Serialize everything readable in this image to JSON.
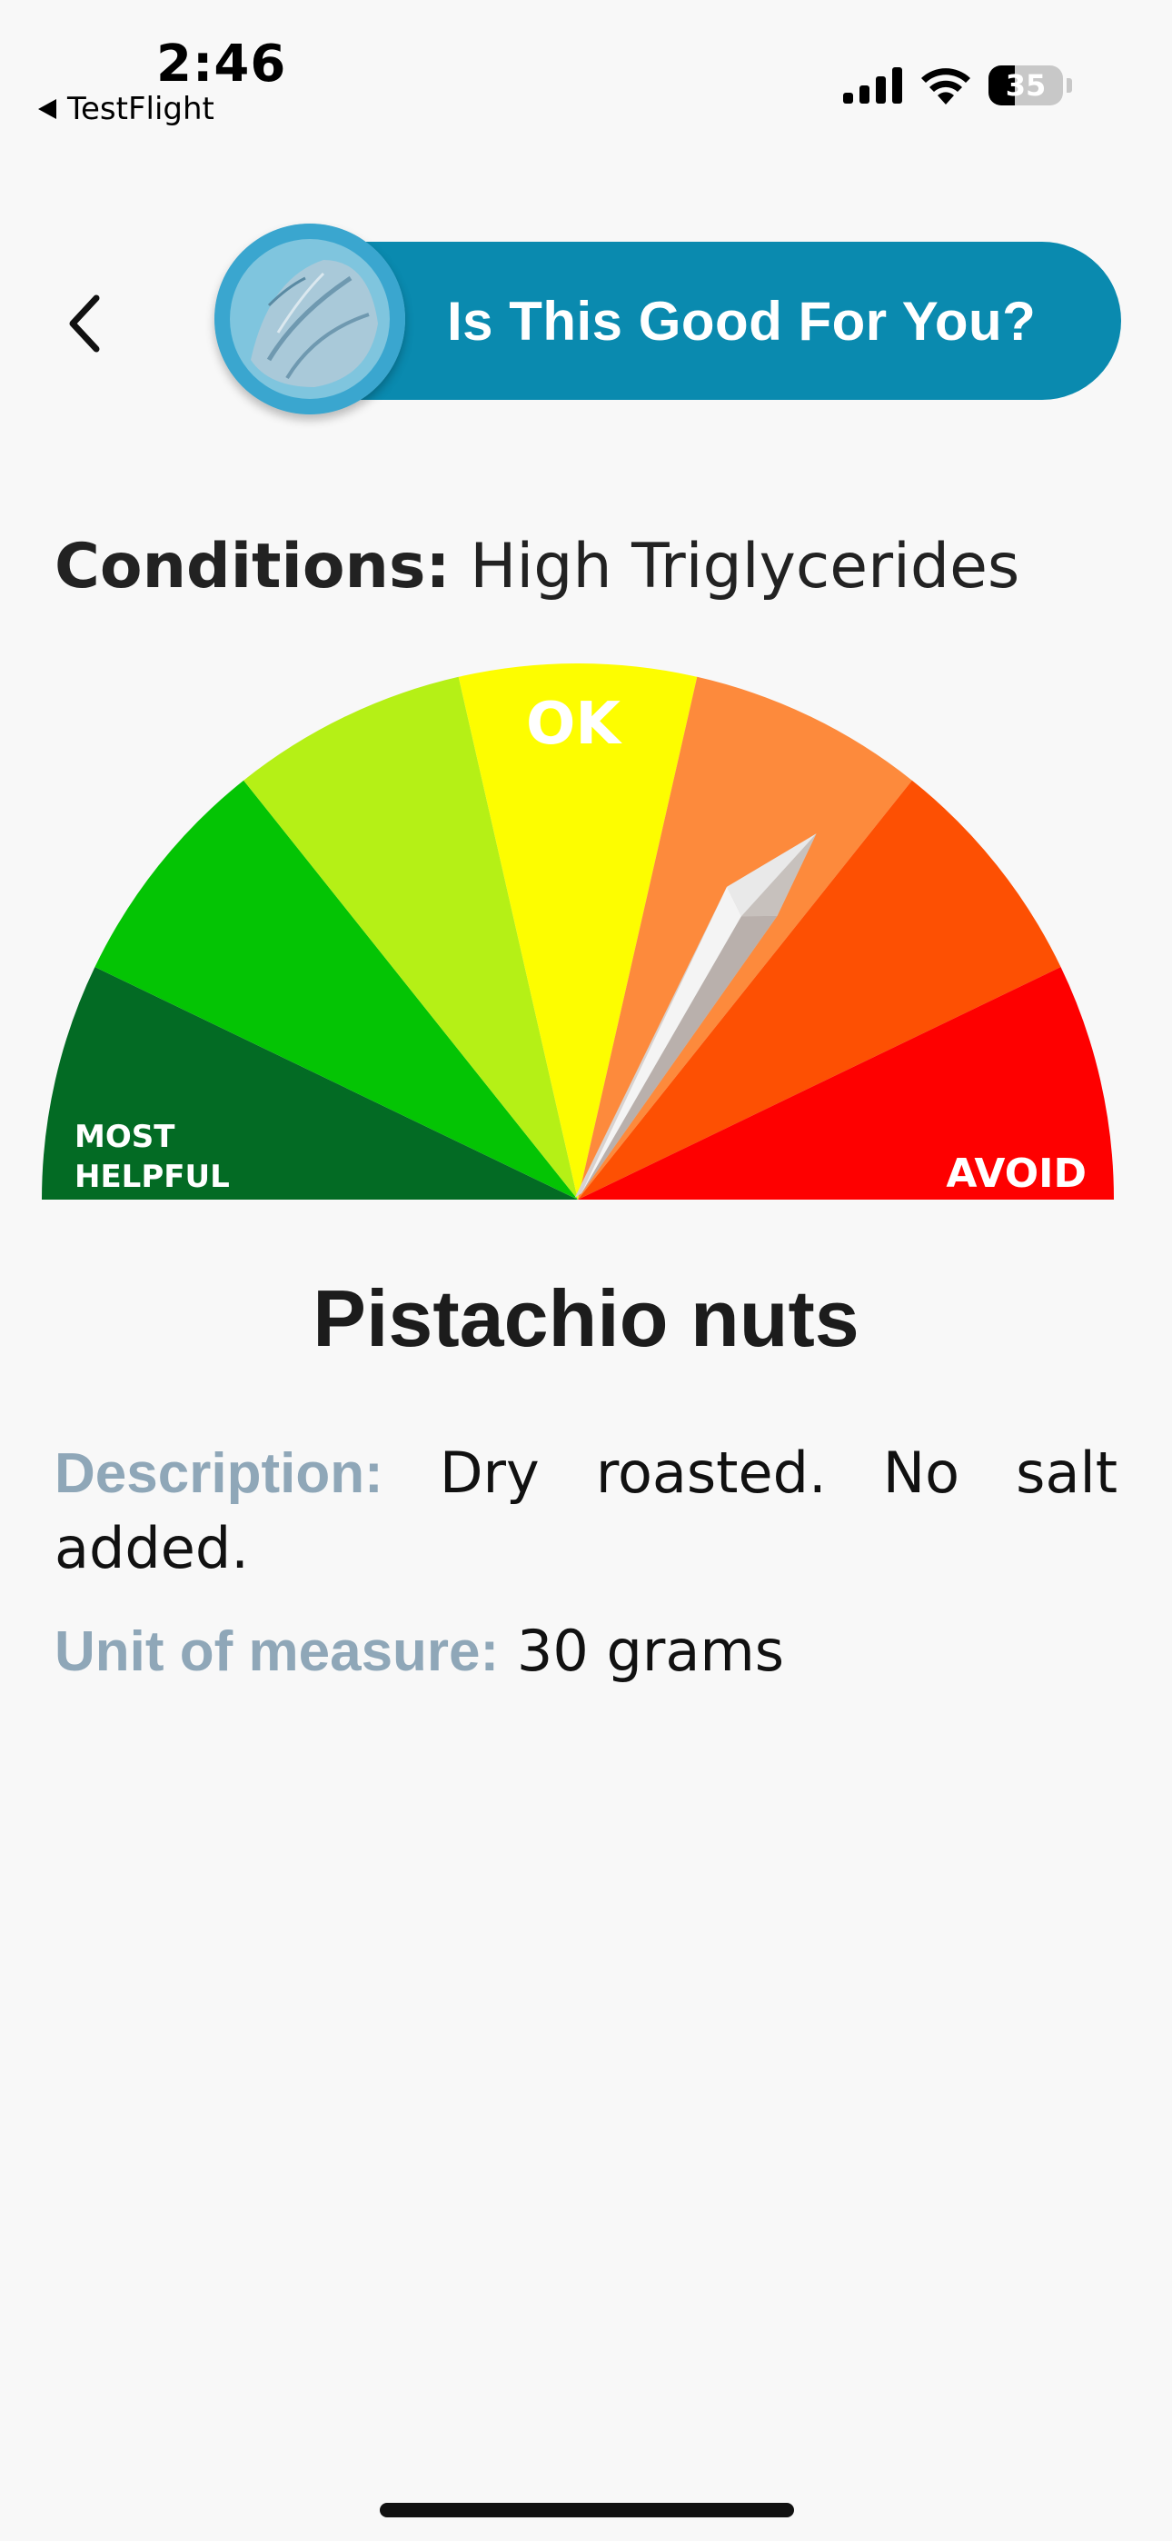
{
  "status_bar": {
    "time": "2:46",
    "back_app": "TestFlight",
    "battery_level": "35",
    "icons": [
      "signal-icon",
      "wifi-icon",
      "battery-icon"
    ]
  },
  "header": {
    "title": "Is This Good For You?",
    "back_icon": "chevron-left-icon",
    "accent_color": "#0a8aaf"
  },
  "conditions": {
    "label": "Conditions:",
    "value": "High Triglycerides"
  },
  "gauge": {
    "label_left_line1": "MOST",
    "label_left_line2": "HELPFUL",
    "label_middle": "OK",
    "label_right": "AVOID",
    "segment_colors": [
      "#036b24",
      "#04c404",
      "#b5f016",
      "#fdfd00",
      "#fd8a3c",
      "#fd5003",
      "#fe0000"
    ],
    "needle_segment": 4
  },
  "food": {
    "name": "Pistachio nuts",
    "description_label": "Description:",
    "description": "Dry roasted. No salt added.",
    "unit_label": "Unit of measure:",
    "unit": "30 grams"
  }
}
